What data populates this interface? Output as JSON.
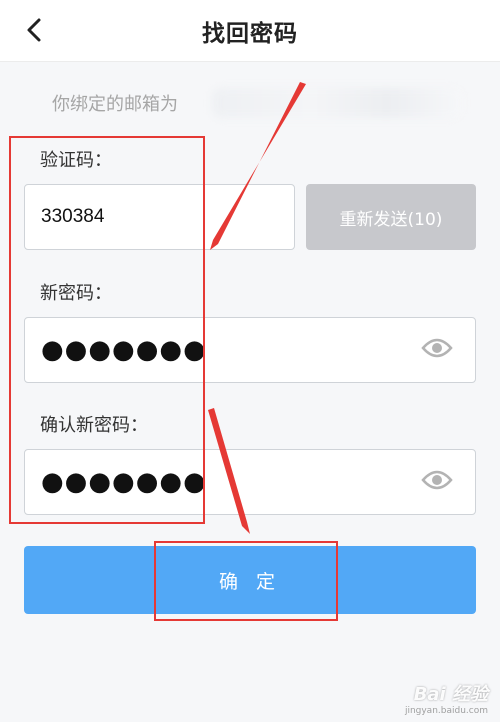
{
  "header": {
    "title": "找回密码",
    "back_icon": "chevron-left-icon"
  },
  "email": {
    "prefix": "你绑定的邮箱为"
  },
  "verify": {
    "label": "验证码：",
    "value": "330384",
    "resend_label": "重新发送(10)"
  },
  "new_password": {
    "label": "新密码：",
    "masked_value": "●●●●●●●"
  },
  "confirm_password": {
    "label": "确认新密码：",
    "masked_value": "●●●●●●●"
  },
  "submit": {
    "label": "确 定"
  },
  "watermark": {
    "main": "Bai 经验",
    "sub": "jingyan.baidu.com"
  },
  "colors": {
    "primary": "#52a8f6",
    "disabled": "#c7c8cc",
    "annotation": "#e53935"
  }
}
